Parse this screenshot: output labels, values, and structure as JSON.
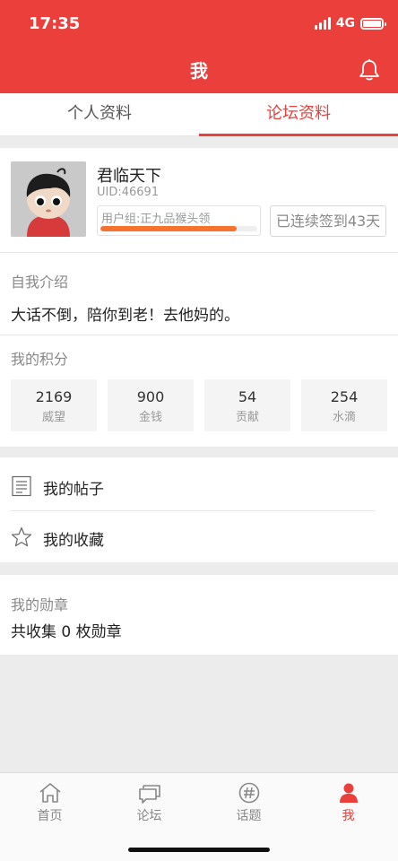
{
  "status": {
    "time": "17:35",
    "network": "4G"
  },
  "header": {
    "title": "我",
    "bell_icon": "bell-icon"
  },
  "tabs": [
    {
      "label": "个人资料",
      "active": false
    },
    {
      "label": "论坛资料",
      "active": true
    }
  ],
  "profile": {
    "username": "君临天下",
    "uid": "UID:46691",
    "group": "用户组:正九品猴头领",
    "group_progress": 0.87,
    "checkin": "已连续签到43天"
  },
  "intro": {
    "title": "自我介绍",
    "text": "大话不倒，陪你到老！去他妈的。"
  },
  "points": {
    "title": "我的积分",
    "items": [
      {
        "value": "2169",
        "label": "威望"
      },
      {
        "value": "900",
        "label": "金钱"
      },
      {
        "value": "54",
        "label": "贡献"
      },
      {
        "value": "254",
        "label": "水滴"
      }
    ]
  },
  "menu": [
    {
      "label": "我的帖子",
      "icon": "document-icon"
    },
    {
      "label": "我的收藏",
      "icon": "star-icon"
    }
  ],
  "medals": {
    "title": "我的勋章",
    "text": "共收集 0 枚勋章"
  },
  "bottom_nav": [
    {
      "label": "首页",
      "icon": "home-icon",
      "active": false
    },
    {
      "label": "论坛",
      "icon": "chat-icon",
      "active": false
    },
    {
      "label": "话题",
      "icon": "hashtag-icon",
      "active": false
    },
    {
      "label": "我",
      "icon": "person-icon",
      "active": true
    }
  ],
  "colors": {
    "brand": "#eb3f3c",
    "progress": "#f5732f"
  }
}
